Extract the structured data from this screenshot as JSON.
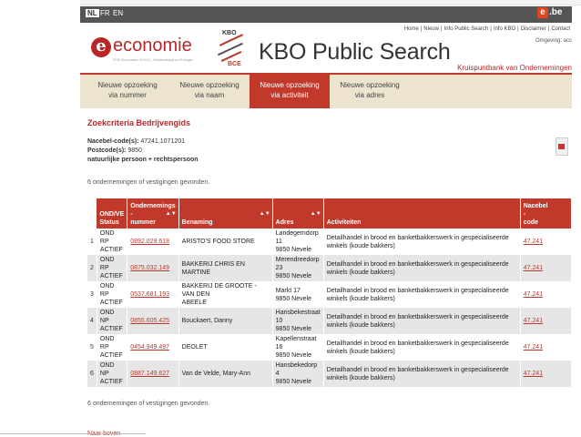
{
  "language_bar": {
    "languages": [
      "NL",
      "FR",
      "EN"
    ]
  },
  "top_links": [
    "Home",
    "Nieuw",
    "Info Public Search",
    "Info KBO",
    "Disclaimer",
    "Contact"
  ],
  "environment_label": "Omgeving: acc",
  "economie_logo": {
    "mark": "e",
    "word": "economie",
    "sub": "FOD Economie, K.M.O., Middenstand en Energie"
  },
  "kbo_mark": {
    "top": "KBO",
    "bottom": "BCE"
  },
  "page_title": "KBO Public Search",
  "page_subtitle": "Kruispuntbank van Ondernemingen",
  "be_logo": {
    "letter": "e",
    "text": ".be"
  },
  "nav": [
    {
      "line1": "Nieuwe opzoeking",
      "line2": "via nummer"
    },
    {
      "line1": "Nieuwe opzoeking",
      "line2": "via naam"
    },
    {
      "line1": "Nieuwe opzoeking",
      "line2": "via activiteit"
    },
    {
      "line1": "Nieuwe opzoeking",
      "line2": "via adres"
    }
  ],
  "criteria": {
    "title": "Zoekcriteria Bedrijvengids",
    "nacebel_label": "Nacebel-code(s):",
    "nacebel_value": "47241,1071201",
    "postcode_label": "Postcode(s):",
    "postcode_value": "9850",
    "type": "natuurlijke persoon + rechtspersoon"
  },
  "result_count": "6 ondernemingen of vestigingen gevonden.",
  "table": {
    "headers": {
      "status": [
        "OND/VE",
        "Status"
      ],
      "nummer": [
        "Ondernemings",
        "-",
        "nummer"
      ],
      "benaming": "Benaming",
      "adres": "Adres",
      "activiteiten": "Activiteiten",
      "nacebel": [
        "Nacebel",
        "-",
        "code"
      ]
    },
    "rows": [
      {
        "index": "1",
        "status": [
          "OND RP",
          "ACTIEF"
        ],
        "nummer": "0892.029.618",
        "benaming": [
          "ARISTO'S FOOD STORE"
        ],
        "adres": [
          "Landegemdorp 11",
          "9850 Nevele"
        ],
        "activiteit": [
          "Detailhandel in brood en banketbakkerswerk in gespecialiseerde",
          "winkels (koude bakkers)"
        ],
        "nacebel": "47.241"
      },
      {
        "index": "2",
        "status": [
          "OND RP",
          "ACTIEF"
        ],
        "nummer": "0875.032.149",
        "benaming": [
          "BAKKERIJ CHRIS EN MARTINE"
        ],
        "adres": [
          "Merendreedorp 23",
          "9850 Nevele"
        ],
        "activiteit": [
          "Detailhandel in brood en banketbakkerswerk in gespecialiseerde",
          "winkels (koude bakkers)"
        ],
        "nacebel": "47.241"
      },
      {
        "index": "3",
        "status": [
          "OND RP",
          "ACTIEF"
        ],
        "nummer": "0537.681.193",
        "benaming": [
          "BAKKERIJ DE GROOTE - VAN DEN",
          "ABEELE"
        ],
        "adres": [
          "Markt 17",
          "9850 Nevele"
        ],
        "activiteit": [
          "Detailhandel in brood en banketbakkerswerk in gespecialiseerde",
          "winkels (koude bakkers)"
        ],
        "nacebel": "47.241"
      },
      {
        "index": "4",
        "status": [
          "OND NP",
          "ACTIEF"
        ],
        "nummer": "0855.605.425",
        "benaming": [
          "Bouckaert, Danny"
        ],
        "adres": [
          "Hansbekestraat 10",
          "9850 Nevele"
        ],
        "activiteit": [
          "Detailhandel in brood en banketbakkerswerk in gespecialiseerde",
          "winkels (koude bakkers)"
        ],
        "nacebel": "47.241"
      },
      {
        "index": "5",
        "status": [
          "OND RP",
          "ACTIEF"
        ],
        "nummer": "0454.949.497",
        "benaming": [
          "DEOLET"
        ],
        "adres": [
          "Kapellenstraat 16",
          "9850 Nevele"
        ],
        "activiteit": [
          "Detailhandel in brood en banketbakkerswerk in gespecialiseerde",
          "winkels (koude bakkers)"
        ],
        "nacebel": "47.241"
      },
      {
        "index": "6",
        "status": [
          "OND NP",
          "ACTIEF"
        ],
        "nummer": "0887.149.627",
        "benaming": [
          "Van de Velde, Mary-Ann"
        ],
        "adres": [
          "Hansbekedorp 4",
          "9850 Nevele"
        ],
        "activiteit": [
          "Detailhandel in brood en banketbakkerswerk in gespecialiseerde",
          "winkels (koude bakkers)"
        ],
        "nacebel": "47.241"
      }
    ]
  },
  "back_to_top": "Naar boven",
  "colors": {
    "brand_red": "#c0392b",
    "nav_bg": "#ece4cf",
    "row_alt": "#e6e6e6"
  }
}
